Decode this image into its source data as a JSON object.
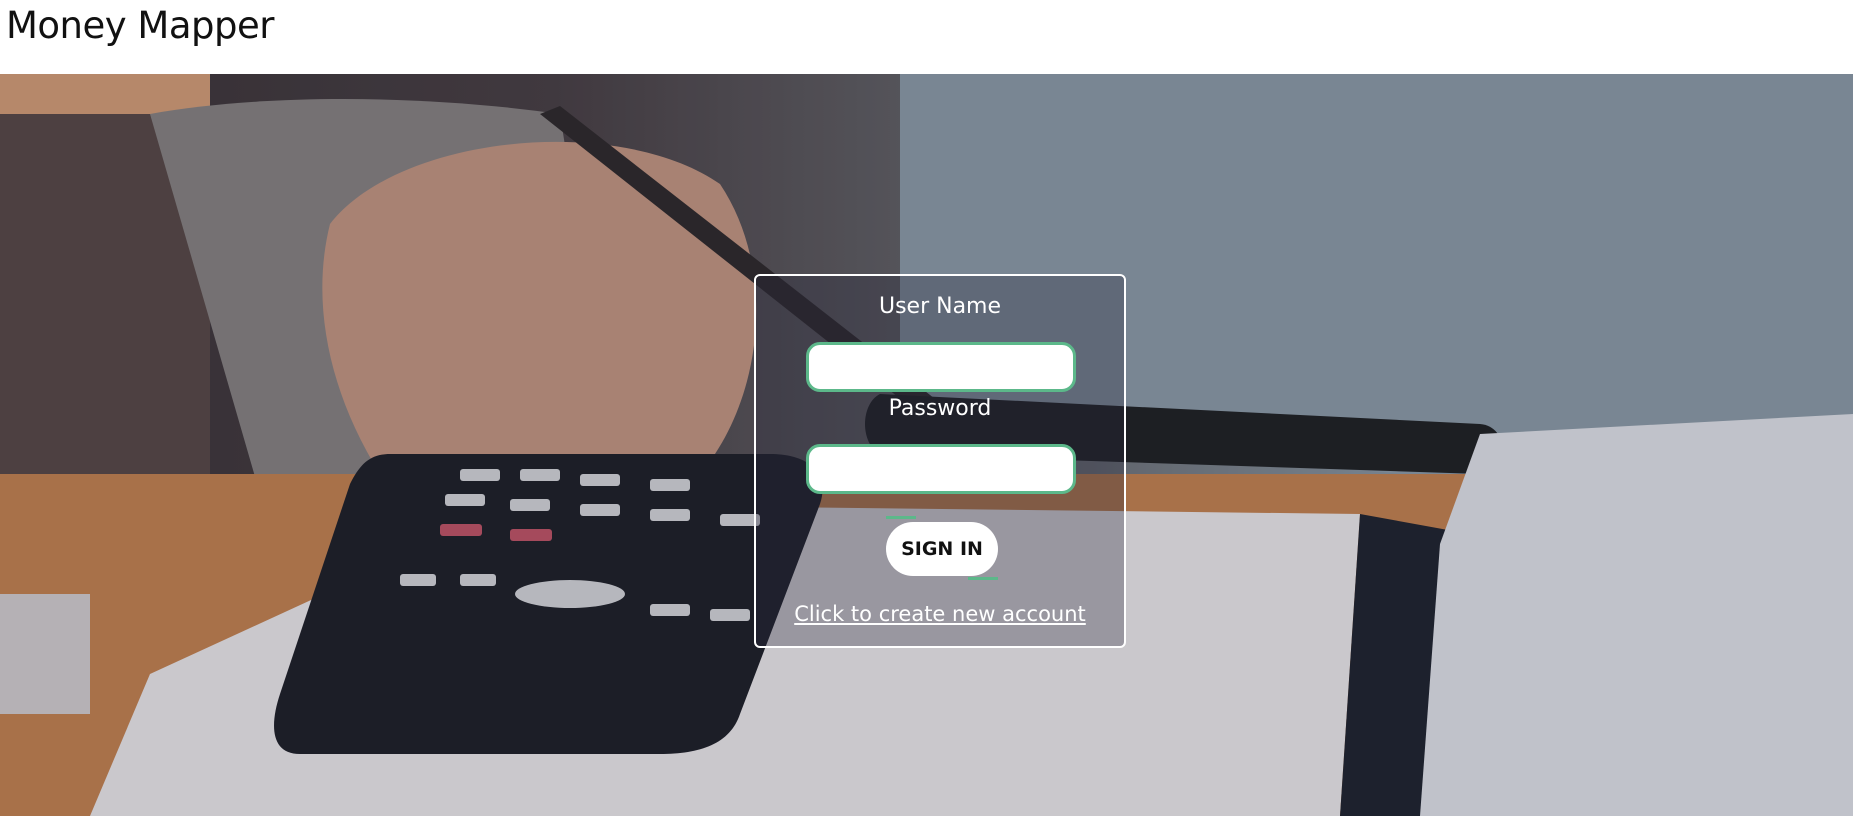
{
  "header": {
    "title": "Money Mapper"
  },
  "login": {
    "username_label": "User Name",
    "username_value": "",
    "password_label": "Password",
    "password_value": "",
    "signin_label": "SIGN IN",
    "create_account_link": "Click to create new account"
  },
  "colors": {
    "input_border": "#5cb88a",
    "panel_border": "#ffffff",
    "button_bg": "#ffffff"
  },
  "icons": {
    "background": "hero-photo-calculator-desk"
  }
}
